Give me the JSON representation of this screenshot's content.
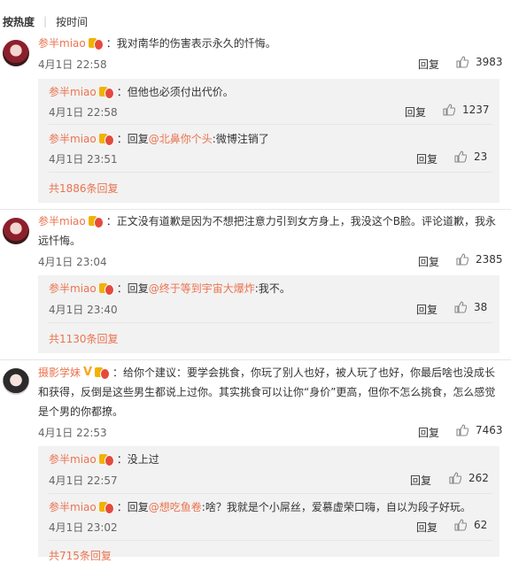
{
  "sort": {
    "hot": "按热度",
    "time": "按时间"
  },
  "comments": [
    {
      "user": "参半miao",
      "text": "我对南华的伤害表示永久的忏悔。",
      "time": "4月1日 22:58",
      "reply": "回复",
      "likes": "3983",
      "replies": [
        {
          "user": "参半miao",
          "text": "但他也必须付出代价。",
          "time": "4月1日 22:58",
          "reply": "回复",
          "likes": "1237"
        },
        {
          "user": "参半miao",
          "prefix": "回复",
          "mention": "@北鼻你个头",
          "text": ":微博注销了",
          "time": "4月1日 23:51",
          "reply": "回复",
          "likes": "23"
        }
      ],
      "more": "共1886条回复"
    },
    {
      "user": "参半miao",
      "text1": "正文没有道歉是因为不想把注意力引到女方身上，我没这个B脸。评论道歉，我永",
      "text2": "远忏悔。",
      "time": "4月1日 23:04",
      "reply": "回复",
      "likes": "2385",
      "replies": [
        {
          "user": "参半miao",
          "prefix": "回复",
          "mention": "@终于等到宇宙大爆炸",
          "text": ":我不。",
          "time": "4月1日 23:40",
          "reply": "回复",
          "likes": "38"
        }
      ],
      "more": "共1130条回复"
    },
    {
      "user": "摄影学妹",
      "text1": "给你个建议：要学会挑食，你玩了别人也好，被人玩了也好，你最后啥也没成长",
      "text2": "和获得，反倒是这些男生都说上过你。其实挑食可以让你“身价”更高，但你不怎么挑食，怎么感觉",
      "text3": "是个男的你都撩。",
      "time": "4月1日 22:53",
      "reply": "回复",
      "likes": "7463",
      "replies": [
        {
          "user": "参半miao",
          "text": "没上过",
          "time": "4月1日 22:57",
          "reply": "回复",
          "likes": "262"
        },
        {
          "user": "参半miao",
          "prefix": "回复",
          "mention": "@想吃鱼卷",
          "text": ":啥？我就是个小屌丝，爱慕虚荣口嗨，自以为段子好玩。",
          "time": "4月1日 23:02",
          "reply": "回复",
          "likes": "62"
        }
      ],
      "more": "共715条回复"
    }
  ]
}
